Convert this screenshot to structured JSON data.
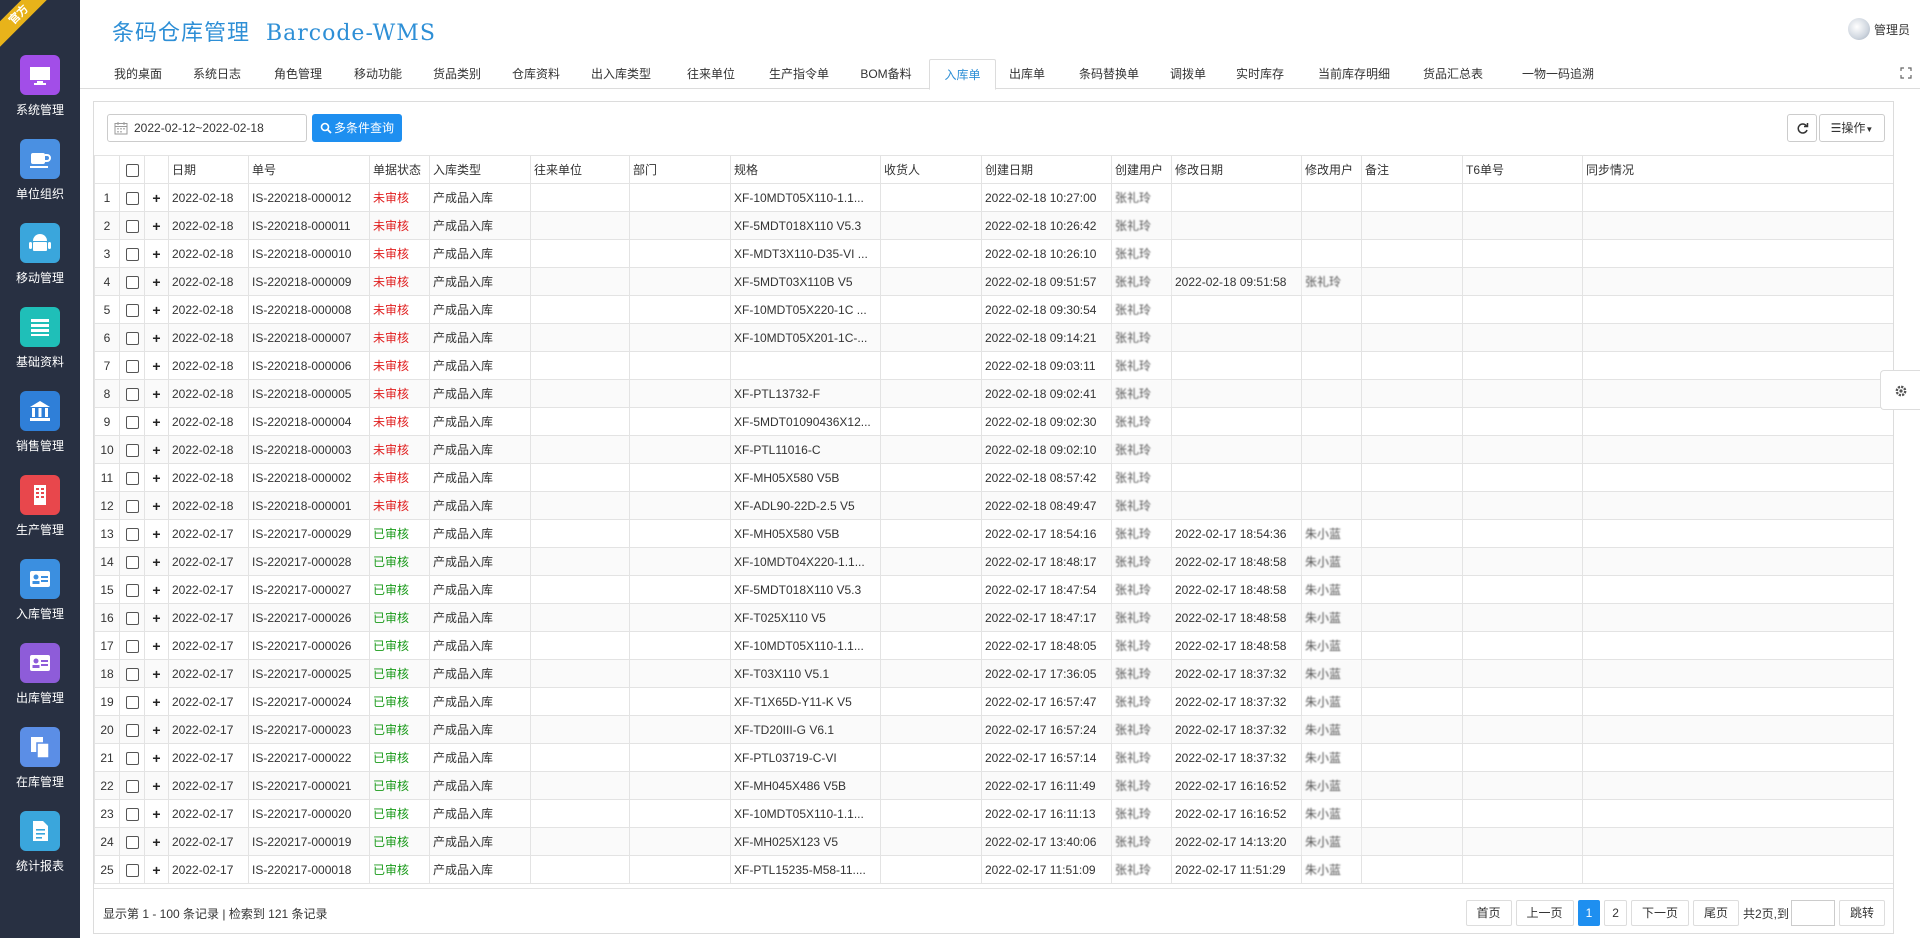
{
  "sidebar": {
    "ribbon": "官方",
    "items": [
      {
        "label": "系统管理",
        "icon": "monitor-icon",
        "color": "#a24ee8"
      },
      {
        "label": "单位组织",
        "icon": "cup-icon",
        "color": "#4a90e2"
      },
      {
        "label": "移动管理",
        "icon": "android-icon",
        "color": "#3aa6dc"
      },
      {
        "label": "基础资料",
        "icon": "list-icon",
        "color": "#1fbfb8"
      },
      {
        "label": "销售管理",
        "icon": "bank-icon",
        "color": "#2f7fd8"
      },
      {
        "label": "生产管理",
        "icon": "building-icon",
        "color": "#e8474c"
      },
      {
        "label": "入库管理",
        "icon": "id-card-icon",
        "color": "#3b8fe0"
      },
      {
        "label": "出库管理",
        "icon": "id-card-out-icon",
        "color": "#8e5cd9"
      },
      {
        "label": "在库管理",
        "icon": "copy-icon",
        "color": "#5b8ee6"
      },
      {
        "label": "统计报表",
        "icon": "document-icon",
        "color": "#3aa6dc"
      }
    ]
  },
  "header": {
    "title": "条码仓库管理  Barcode-WMS",
    "user": "管理员"
  },
  "tabs": [
    {
      "label": "我的桌面"
    },
    {
      "label": "系统日志"
    },
    {
      "label": "角色管理"
    },
    {
      "label": "移动功能"
    },
    {
      "label": "货品类别"
    },
    {
      "label": "仓库资料"
    },
    {
      "label": "出入库类型"
    },
    {
      "label": "往来单位"
    },
    {
      "label": "生产指令单"
    },
    {
      "label": "BOM备料"
    },
    {
      "label": "入库单"
    },
    {
      "label": "出库单"
    },
    {
      "label": "条码替换单"
    },
    {
      "label": "调拨单"
    },
    {
      "label": "实时库存"
    },
    {
      "label": "当前库存明细"
    },
    {
      "label": "货品汇总表"
    },
    {
      "label": "一物一码追溯"
    }
  ],
  "toolbar": {
    "date_range": "2022-02-12~2022-02-18",
    "search_label": "多条件查询",
    "ops_label": "操作"
  },
  "table": {
    "headers": [
      "日期",
      "单号",
      "单据状态",
      "入库类型",
      "往来单位",
      "部门",
      "规格",
      "收货人",
      "创建日期",
      "创建用户",
      "修改日期",
      "修改用户",
      "备注",
      "T6单号",
      "同步情况"
    ],
    "rows": [
      [
        "2022-02-18",
        "IS-220218-000012",
        "未审核",
        "产成品入库",
        "",
        "",
        "XF-10MDT05X110-1.1...",
        "",
        "2022-02-18 10:27:00",
        "张礼玲",
        "",
        ""
      ],
      [
        "2022-02-18",
        "IS-220218-000011",
        "未审核",
        "产成品入库",
        "",
        "",
        "XF-5MDT018X110 V5.3",
        "",
        "2022-02-18 10:26:42",
        "张礼玲",
        "",
        ""
      ],
      [
        "2022-02-18",
        "IS-220218-000010",
        "未审核",
        "产成品入库",
        "",
        "",
        "XF-MDT3X110-D35-VI ...",
        "",
        "2022-02-18 10:26:10",
        "张礼玲",
        "",
        ""
      ],
      [
        "2022-02-18",
        "IS-220218-000009",
        "未审核",
        "产成品入库",
        "",
        "",
        "XF-5MDT03X110B V5",
        "",
        "2022-02-18 09:51:57",
        "张礼玲",
        "2022-02-18 09:51:58",
        "张礼玲"
      ],
      [
        "2022-02-18",
        "IS-220218-000008",
        "未审核",
        "产成品入库",
        "",
        "",
        "XF-10MDT05X220-1C ...",
        "",
        "2022-02-18 09:30:54",
        "张礼玲",
        "",
        ""
      ],
      [
        "2022-02-18",
        "IS-220218-000007",
        "未审核",
        "产成品入库",
        "",
        "",
        "XF-10MDT05X201-1C-...",
        "",
        "2022-02-18 09:14:21",
        "张礼玲",
        "",
        ""
      ],
      [
        "2022-02-18",
        "IS-220218-000006",
        "未审核",
        "产成品入库",
        "",
        "",
        "",
        "",
        "2022-02-18 09:03:11",
        "张礼玲",
        "",
        ""
      ],
      [
        "2022-02-18",
        "IS-220218-000005",
        "未审核",
        "产成品入库",
        "",
        "",
        "XF-PTL13732-F",
        "",
        "2022-02-18 09:02:41",
        "张礼玲",
        "",
        ""
      ],
      [
        "2022-02-18",
        "IS-220218-000004",
        "未审核",
        "产成品入库",
        "",
        "",
        "XF-5MDT01090436X12...",
        "",
        "2022-02-18 09:02:30",
        "张礼玲",
        "",
        ""
      ],
      [
        "2022-02-18",
        "IS-220218-000003",
        "未审核",
        "产成品入库",
        "",
        "",
        "XF-PTL11016-C",
        "",
        "2022-02-18 09:02:10",
        "张礼玲",
        "",
        ""
      ],
      [
        "2022-02-18",
        "IS-220218-000002",
        "未审核",
        "产成品入库",
        "",
        "",
        "XF-MH05X580 V5B",
        "",
        "2022-02-18 08:57:42",
        "张礼玲",
        "",
        ""
      ],
      [
        "2022-02-18",
        "IS-220218-000001",
        "未审核",
        "产成品入库",
        "",
        "",
        "XF-ADL90-22D-2.5 V5",
        "",
        "2022-02-18 08:49:47",
        "张礼玲",
        "",
        ""
      ],
      [
        "2022-02-17",
        "IS-220217-000029",
        "已审核",
        "产成品入库",
        "",
        "",
        "XF-MH05X580 V5B",
        "",
        "2022-02-17 18:54:16",
        "张礼玲",
        "2022-02-17 18:54:36",
        "朱小蓝"
      ],
      [
        "2022-02-17",
        "IS-220217-000028",
        "已审核",
        "产成品入库",
        "",
        "",
        "XF-10MDT04X220-1.1...",
        "",
        "2022-02-17 18:48:17",
        "张礼玲",
        "2022-02-17 18:48:58",
        "朱小蓝"
      ],
      [
        "2022-02-17",
        "IS-220217-000027",
        "已审核",
        "产成品入库",
        "",
        "",
        "XF-5MDT018X110 V5.3",
        "",
        "2022-02-17 18:47:54",
        "张礼玲",
        "2022-02-17 18:48:58",
        "朱小蓝"
      ],
      [
        "2022-02-17",
        "IS-220217-000026",
        "已审核",
        "产成品入库",
        "",
        "",
        "XF-T025X110 V5",
        "",
        "2022-02-17 18:47:17",
        "张礼玲",
        "2022-02-17 18:48:58",
        "朱小蓝"
      ],
      [
        "2022-02-17",
        "IS-220217-000026",
        "已审核",
        "产成品入库",
        "",
        "",
        "XF-10MDT05X110-1.1...",
        "",
        "2022-02-17 18:48:05",
        "张礼玲",
        "2022-02-17 18:48:58",
        "朱小蓝"
      ],
      [
        "2022-02-17",
        "IS-220217-000025",
        "已审核",
        "产成品入库",
        "",
        "",
        "XF-T03X110 V5.1",
        "",
        "2022-02-17 17:36:05",
        "张礼玲",
        "2022-02-17 18:37:32",
        "朱小蓝"
      ],
      [
        "2022-02-17",
        "IS-220217-000024",
        "已审核",
        "产成品入库",
        "",
        "",
        "XF-T1X65D-Y11-K V5",
        "",
        "2022-02-17 16:57:47",
        "张礼玲",
        "2022-02-17 18:37:32",
        "朱小蓝"
      ],
      [
        "2022-02-17",
        "IS-220217-000023",
        "已审核",
        "产成品入库",
        "",
        "",
        "XF-TD20III-G V6.1",
        "",
        "2022-02-17 16:57:24",
        "张礼玲",
        "2022-02-17 18:37:32",
        "朱小蓝"
      ],
      [
        "2022-02-17",
        "IS-220217-000022",
        "已审核",
        "产成品入库",
        "",
        "",
        "XF-PTL03719-C-VI",
        "",
        "2022-02-17 16:57:14",
        "张礼玲",
        "2022-02-17 18:37:32",
        "朱小蓝"
      ],
      [
        "2022-02-17",
        "IS-220217-000021",
        "已审核",
        "产成品入库",
        "",
        "",
        "XF-MH045X486 V5B",
        "",
        "2022-02-17 16:11:49",
        "张礼玲",
        "2022-02-17 16:16:52",
        "朱小蓝"
      ],
      [
        "2022-02-17",
        "IS-220217-000020",
        "已审核",
        "产成品入库",
        "",
        "",
        "XF-10MDT05X110-1.1...",
        "",
        "2022-02-17 16:11:13",
        "张礼玲",
        "2022-02-17 16:16:52",
        "朱小蓝"
      ],
      [
        "2022-02-17",
        "IS-220217-000019",
        "已审核",
        "产成品入库",
        "",
        "",
        "XF-MH025X123 V5",
        "",
        "2022-02-17 13:40:06",
        "张礼玲",
        "2022-02-17 14:13:20",
        "朱小蓝"
      ],
      [
        "2022-02-17",
        "IS-220217-000018",
        "已审核",
        "产成品入库",
        "",
        "",
        "XF-PTL15235-M58-11....",
        "",
        "2022-02-17 11:51:09",
        "张礼玲",
        "2022-02-17 11:51:29",
        "朱小蓝"
      ]
    ]
  },
  "footer": {
    "info": "显示第 1 - 100 条记录 | 检索到 121 条记录",
    "first": "首页",
    "prev": "上一页",
    "page1": "1",
    "page2": "2",
    "next": "下一页",
    "last": "尾页",
    "total_pages": "共2页,到",
    "go": "跳转"
  },
  "colors": {
    "accent": "#1e8ff0",
    "sidebar_bg": "#283042",
    "unreviewed": "#e02020",
    "reviewed": "#1a9a1a"
  }
}
